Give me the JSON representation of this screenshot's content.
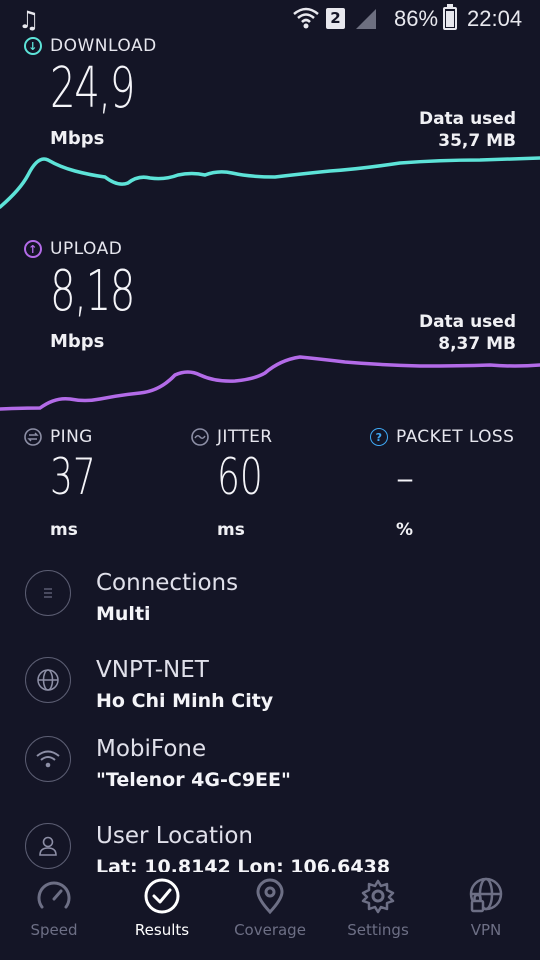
{
  "status_bar": {
    "sim_slot": "2",
    "battery": "86%",
    "time": "22:04"
  },
  "download": {
    "label": "DOWNLOAD",
    "value": "24,9",
    "unit": "Mbps",
    "data_used_label": "Data used",
    "data_used_value": "35,7 MB",
    "color": "#5de3d8"
  },
  "upload": {
    "label": "UPLOAD",
    "value": "8,18",
    "unit": "Mbps",
    "data_used_label": "Data used",
    "data_used_value": "8,37 MB",
    "color": "#b36be8"
  },
  "metrics": {
    "ping": {
      "label": "PING",
      "value": "37",
      "unit": "ms"
    },
    "jitter": {
      "label": "JITTER",
      "value": "60",
      "unit": "ms"
    },
    "packet_loss": {
      "label": "PACKET LOSS",
      "value": "–",
      "unit": "%"
    }
  },
  "info": {
    "connections": {
      "title": "Connections",
      "value": "Multi",
      "icon": "connections-icon"
    },
    "isp": {
      "title": "VNPT-NET",
      "value": "Ho Chi Minh City",
      "icon": "globe-icon"
    },
    "network": {
      "title": "MobiFone",
      "value": "\"Telenor 4G-C9EE\"",
      "icon": "wifi-icon"
    },
    "location": {
      "title": "User Location",
      "value": "Lat: 10,8142 Lon: 106,6438",
      "icon": "user-icon"
    }
  },
  "nav": {
    "items": [
      {
        "label": "Speed",
        "icon": "speedometer-icon",
        "active": false
      },
      {
        "label": "Results",
        "icon": "check-circle-icon",
        "active": true
      },
      {
        "label": "Coverage",
        "icon": "map-pin-icon",
        "active": false
      },
      {
        "label": "Settings",
        "icon": "gear-icon",
        "active": false
      },
      {
        "label": "VPN",
        "icon": "vpn-lock-icon",
        "active": false
      }
    ]
  }
}
